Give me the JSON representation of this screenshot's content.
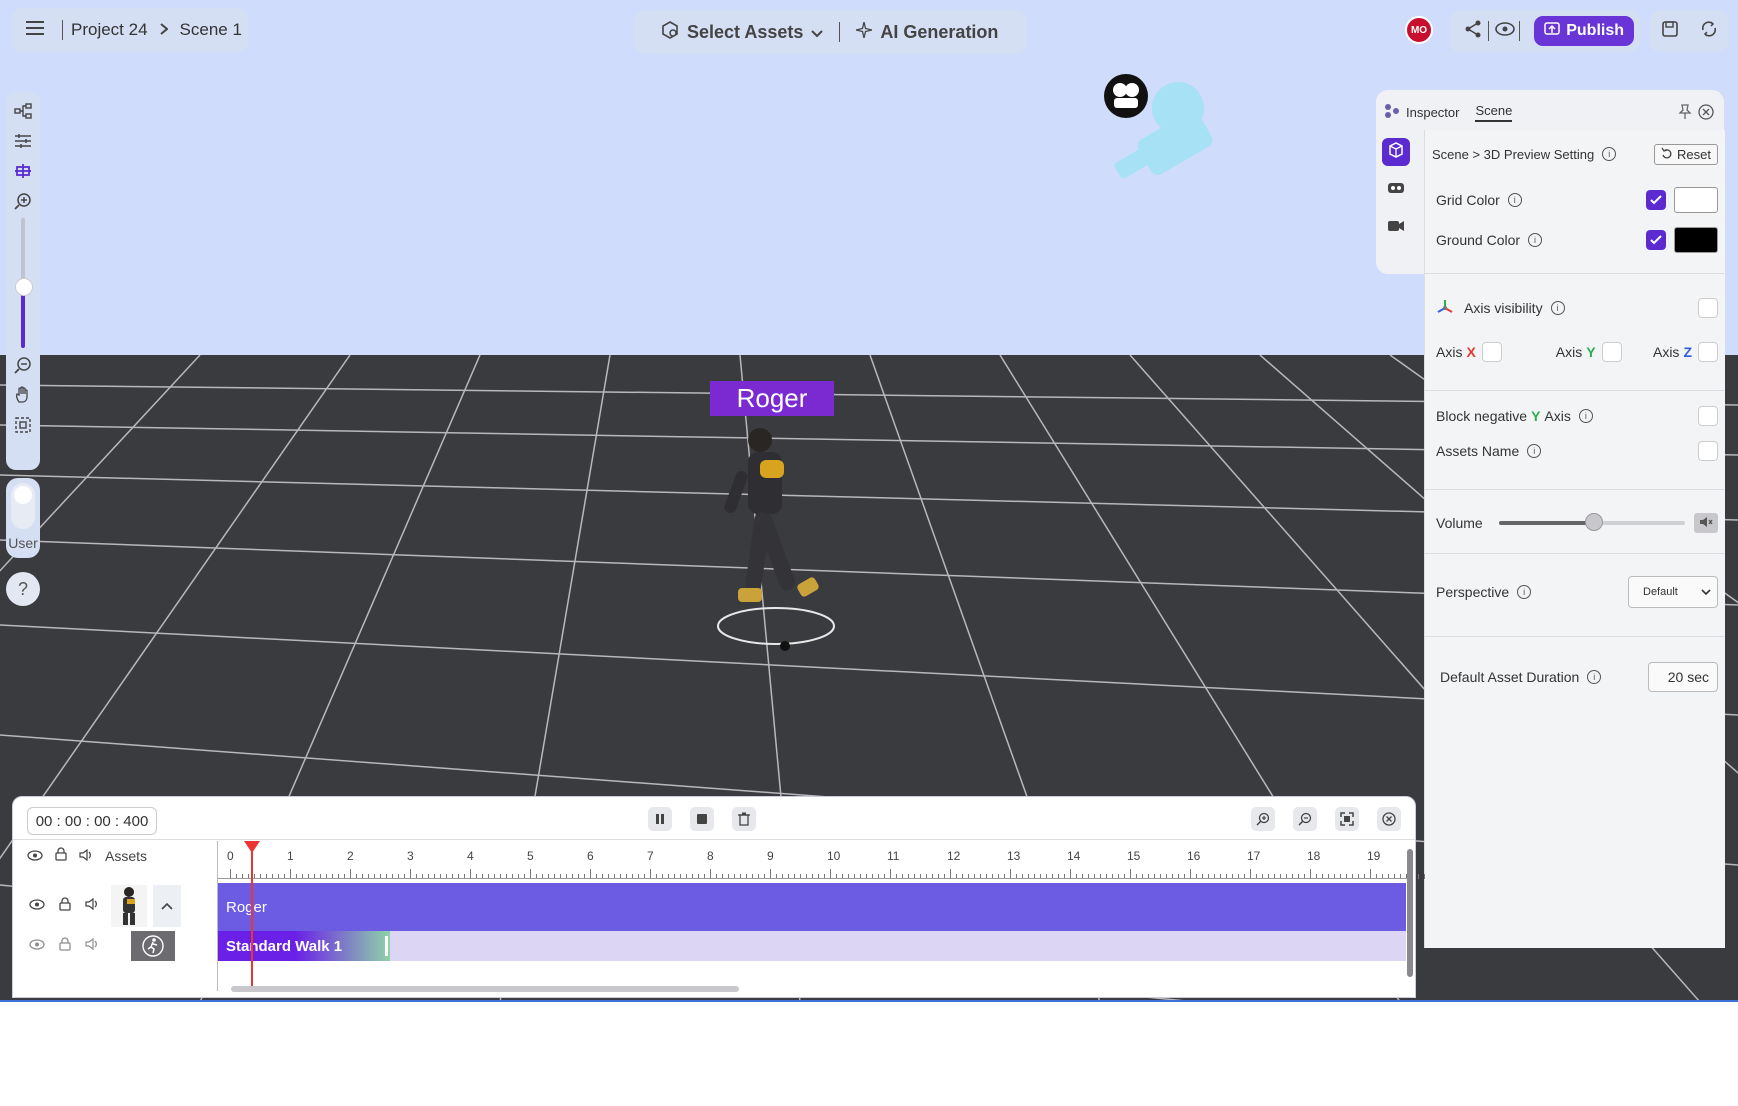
{
  "header": {
    "breadcrumb": {
      "project": "Project 24",
      "scene": "Scene 1"
    },
    "select_assets_label": "Select Assets",
    "ai_generation_label": "AI Generation",
    "user_initials": "MO",
    "publish_label": "Publish"
  },
  "left_toolbar": {
    "user_label": "User",
    "help_label": "?"
  },
  "scene": {
    "character_label": "Roger"
  },
  "inspector": {
    "tabs": [
      "Inspector",
      "Scene"
    ],
    "breadcrumb": "Scene > 3D Preview Setting",
    "reset_label": "Reset",
    "grid_color_label": "Grid Color",
    "grid_color": "#ffffff",
    "grid_color_checked": true,
    "ground_color_label": "Ground Color",
    "ground_color": "#000000",
    "ground_color_checked": true,
    "axis_visibility_label": "Axis visibility",
    "axis_x_label": "Axis",
    "axis_x_letter": "X",
    "axis_y_label": "Axis",
    "axis_y_letter": "Y",
    "axis_z_label": "Axis",
    "axis_z_letter": "Z",
    "block_negative_prefix": "Block negative",
    "block_negative_letter": "Y",
    "block_negative_suffix": "Axis",
    "assets_name_label": "Assets Name",
    "volume_label": "Volume",
    "volume_level": 0.5,
    "perspective_label": "Perspective",
    "perspective_value": "Default",
    "default_duration_label": "Default Asset Duration",
    "default_duration_value": "20 sec"
  },
  "timeline": {
    "time_display": "00 : 00 : 00 : 400",
    "assets_label": "Assets",
    "ruler_ticks": [
      "0",
      "1",
      "2",
      "3",
      "4",
      "5",
      "6",
      "7",
      "8",
      "9",
      "10",
      "11",
      "12",
      "13",
      "14",
      "15",
      "16",
      "17",
      "18",
      "19"
    ],
    "tracks": {
      "main_label": "Roger",
      "clip_label": "Standard Walk 1"
    }
  },
  "colors": {
    "accent": "#5b2bd0",
    "publish": "#6a35d6",
    "track_main": "#6c5ce4",
    "character_label_bg": "#7a2ad0",
    "axis_x": "#e53935",
    "axis_y": "#2eae4f",
    "axis_z": "#2f5fe0"
  }
}
